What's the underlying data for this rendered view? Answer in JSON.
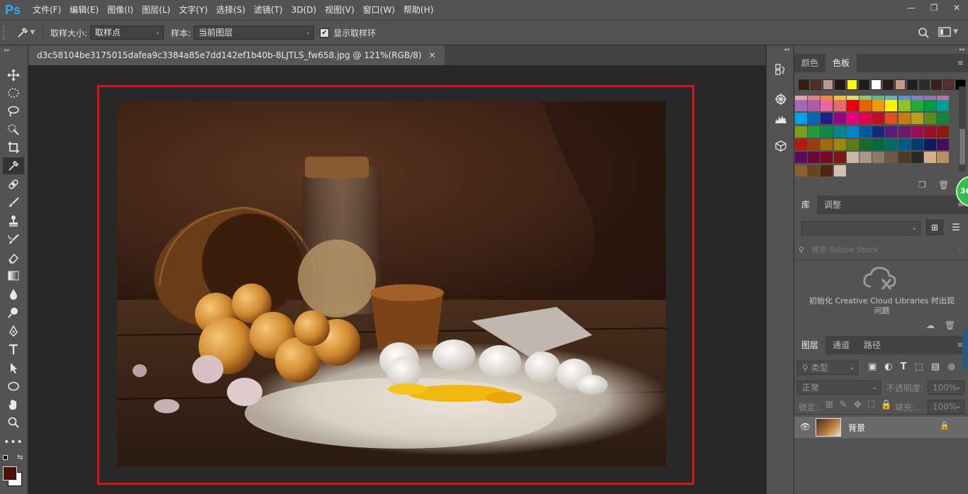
{
  "app": {
    "logo": "Ps"
  },
  "menu": [
    "文件(F)",
    "编辑(E)",
    "图像(I)",
    "图层(L)",
    "文字(Y)",
    "选择(S)",
    "滤镜(T)",
    "3D(D)",
    "视图(V)",
    "窗口(W)",
    "帮助(H)"
  ],
  "window_controls": {
    "minimize": "—",
    "restore": "❐",
    "close": "✕"
  },
  "options": {
    "sample_size_label": "取样大小:",
    "sample_size_value": "取样点",
    "sample_label": "样本:",
    "sample_value": "当前图层",
    "show_ring_label": "显示取样环",
    "show_ring_checked": true
  },
  "document": {
    "tab_title": "d3c58104be3175015dafea9c3384a85e7dd142ef1b40b-8LJTLS_fw658.jpg @ 121%(RGB/8)",
    "close": "✕"
  },
  "swatches_panel": {
    "tabs": [
      "颜色",
      "色板"
    ],
    "active_tab": "色板",
    "recent": [
      "#3b1a14",
      "#5a2d22",
      "#b59a8a",
      "#2a1510",
      "#ffff00",
      "#1d1d1d",
      "#ffffff",
      "#2b1a14",
      "#c49a84",
      "#1f1f1f",
      "#2d2d2d",
      "#3a2020",
      "#5c3030",
      "#000000"
    ],
    "grid": [
      [
        "#e4a3b0",
        "#e08080",
        "#e88a3a",
        "#f0c040",
        "#d8e060",
        "#90c878",
        "#60b890",
        "#60b0c0",
        "#6090d0",
        "#8080c8",
        "#a070b0",
        "#c070a0"
      ],
      [
        "#a36bb4",
        "#b05aa8",
        "#e7679e",
        "#e56b6b",
        "#e60012",
        "#eb6100",
        "#f39800",
        "#fff100",
        "#8fc31f",
        "#22ac38",
        "#009944",
        "#009e96"
      ],
      [
        "#00a0e9",
        "#0068b7",
        "#1d2088",
        "#920783",
        "#e4007f",
        "#e5004f",
        "#c30d23",
        "#e3501f",
        "#c87b14",
        "#b7a11b",
        "#5f8a1e",
        "#19823a"
      ],
      [
        "#7d9d1c",
        "#1f9a3c",
        "#0f8a46",
        "#00878a",
        "#0086c7",
        "#00599e",
        "#172a78",
        "#5a1a7a",
        "#6a1a6a",
        "#9c0c5a",
        "#a00c2e",
        "#8c1a10"
      ],
      [
        "#b8180c",
        "#9c3c08",
        "#a06a08",
        "#9a8a0c",
        "#5a7c14",
        "#166a2c",
        "#006a38",
        "#006a68",
        "#005a8a",
        "#003c70",
        "#101a5c",
        "#40105c"
      ],
      [
        "#5a0e5a",
        "#6a0a3c",
        "#7a0a24",
        "#7a1a10",
        "#c8b8a8",
        "#a89888",
        "#8a7a6a",
        "#6a5a4a",
        "#4a3a2a",
        "#2a2a2a",
        "#d8b088",
        "#b89060"
      ],
      [
        "#8a6030",
        "#6a4420",
        "#4a2810",
        "#d0c0b0"
      ]
    ]
  },
  "library_panel": {
    "tabs": [
      "库",
      "调整"
    ],
    "active_tab": "库",
    "search_placeholder": "搜索 Adobe Stock",
    "message": "初始化 Creative Cloud Libraries 时出现问题"
  },
  "layers_panel": {
    "tabs": [
      "图层",
      "通道",
      "路径"
    ],
    "active_tab": "图层",
    "filter_label": "类型",
    "blend_mode": "正常",
    "opacity_label": "不透明度:",
    "opacity_value": "100%",
    "lock_label": "锁定:",
    "fill_label": "填充:",
    "fill_value": "100%",
    "layers": [
      {
        "name": "背景",
        "visible": true,
        "locked": true
      }
    ]
  },
  "badge": {
    "text": "36"
  },
  "colors": {
    "fg": "#4a1208",
    "bg": "#ffffff",
    "accent": "#31a8ff",
    "highlight_border": "#d41515"
  }
}
